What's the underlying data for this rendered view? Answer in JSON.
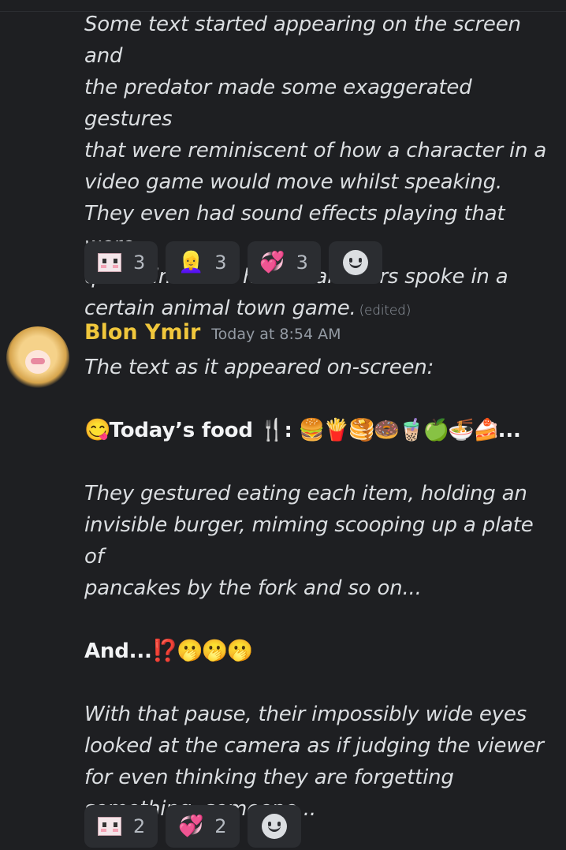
{
  "message_prev": {
    "text_lines": [
      "Some text started appearing on the screen and",
      "the predator made some exaggerated gestures",
      "that were reminiscent of how a character in a",
      "video game would move whilst speaking.",
      "They even had sound effects playing that were",
      "quite similar to how characters spoke in a",
      "certain animal town game."
    ],
    "edited_label": "(edited)",
    "reactions": [
      {
        "icon": "blush-face-emoji",
        "count": "3"
      },
      {
        "icon": "anime-girl-emoji",
        "count": "3",
        "glyph": "👱‍♀️"
      },
      {
        "icon": "two-hearts-emoji",
        "count": "3",
        "glyph": "💞"
      }
    ]
  },
  "message": {
    "author": "Blon Ymir",
    "timestamp": "Today at 8:54 AM",
    "intro": "The text as it appeared on-screen:",
    "food_line": {
      "prefix_emoji": "😋",
      "label": "Today’s food",
      "utensil_emoji": "🍴",
      "colon": ":",
      "emojis": "🍔🍟🥞🍩🧋🍏🍜🍰",
      "ellipsis": "..."
    },
    "para2_lines": [
      "They gestured eating each item, holding an",
      "invisible burger, miming scooping up a plate of",
      "pancakes by the fork and so on..."
    ],
    "and_line": {
      "label": "And...",
      "emojis": "⁉️🫢🫢🫢"
    },
    "para3_lines": [
      "With that pause, their impossibly wide eyes",
      "looked at the camera as if judging the viewer",
      "for even thinking they are forgetting",
      "something, someone..."
    ],
    "reactions": [
      {
        "icon": "blush-face-emoji",
        "count": "2"
      },
      {
        "icon": "two-hearts-emoji",
        "count": "2",
        "glyph": "💞"
      }
    ]
  }
}
